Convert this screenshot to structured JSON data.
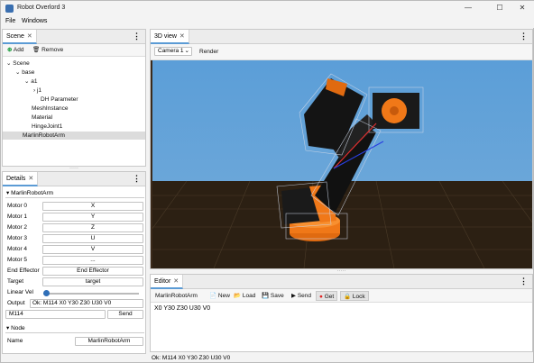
{
  "window": {
    "title": "Robot Overlord 3",
    "min": "—",
    "max": "☐",
    "close": "✕"
  },
  "menu": [
    "File",
    "Windows"
  ],
  "scene": {
    "tab": "Scene",
    "add": "Add",
    "remove": "Remove",
    "tree": [
      {
        "label": "Scene",
        "arrow": "⌄"
      },
      {
        "label": "base",
        "arrow": "⌄"
      },
      {
        "label": "a1",
        "arrow": "⌄"
      },
      {
        "label": "j1",
        "arrow": "›"
      },
      {
        "label": "DH Parameter",
        "arrow": ""
      },
      {
        "label": "MeshInstance",
        "arrow": ""
      },
      {
        "label": "Material",
        "arrow": ""
      },
      {
        "label": "HingeJoint1",
        "arrow": ""
      },
      {
        "label": "MarlinRobotArm",
        "arrow": ""
      }
    ]
  },
  "details": {
    "tab": "Details",
    "section": "MarlinRobotArm",
    "motors": [
      {
        "label": "Motor 0",
        "value": "X"
      },
      {
        "label": "Motor 1",
        "value": "Y"
      },
      {
        "label": "Motor 2",
        "value": "Z"
      },
      {
        "label": "Motor 3",
        "value": "U"
      },
      {
        "label": "Motor 4",
        "value": "V"
      },
      {
        "label": "Motor 5",
        "value": "..."
      },
      {
        "label": "End Effector",
        "value": "End Effector"
      },
      {
        "label": "Target",
        "value": "target"
      }
    ],
    "linear_vel": {
      "label": "Linear Vel",
      "level": 0.03
    },
    "output": {
      "label": "Output",
      "value": "Ok: M114 X0 Y30 Z30 U30 V0"
    },
    "command": {
      "value": "M114",
      "send": "Send"
    },
    "node_section": "Node",
    "name": {
      "label": "Name",
      "value": "MarlinRobotArm"
    }
  },
  "view3d": {
    "tab": "3D view",
    "camera": "Camera 1",
    "render": "Render"
  },
  "editor": {
    "tab": "Editor",
    "robot": "MarlinRobotArm",
    "new": "New",
    "load": "Load",
    "save": "Save",
    "send": "Send",
    "get": "Get",
    "lock": "Lock",
    "content": "X0 Y30 Z30 U30 V0"
  },
  "status": "Ok: M114 X0 Y30 Z30 U30 V0",
  "colors": {
    "accent": "#5b9bd5",
    "sky": "#5b9ed8",
    "ground": "#2c2013",
    "robot_orange": "#f07818"
  }
}
